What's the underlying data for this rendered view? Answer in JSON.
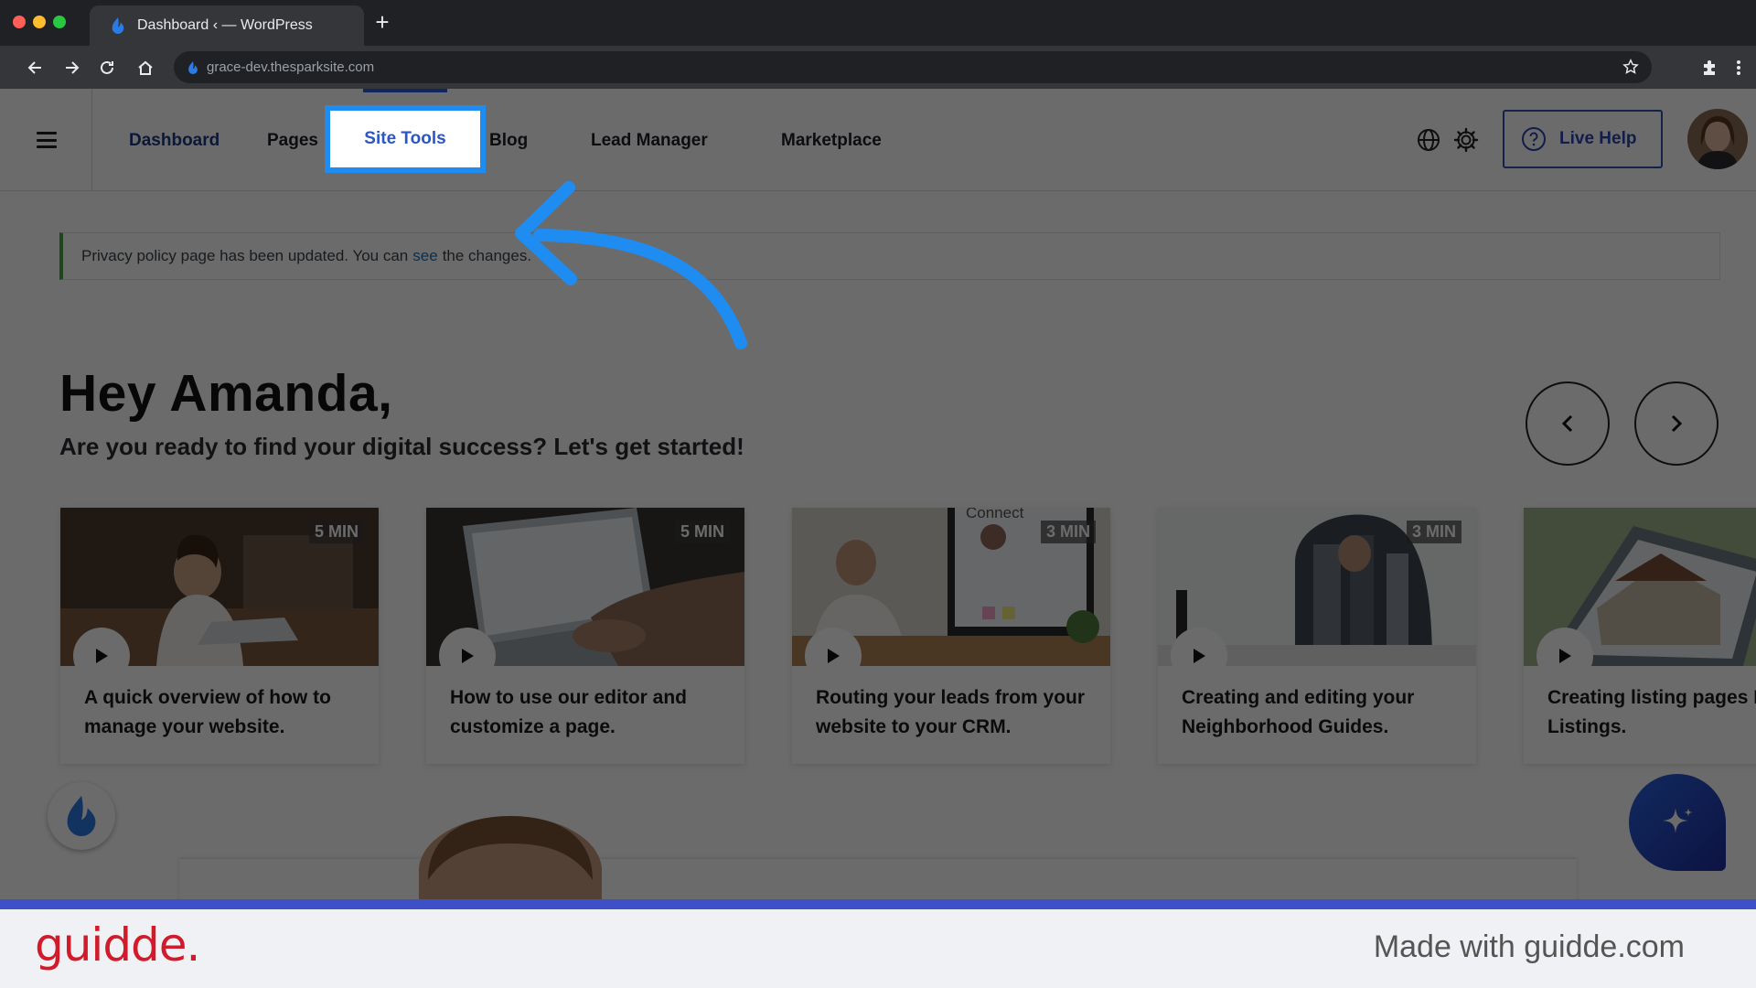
{
  "browser": {
    "tab_title": "Dashboard ‹ — WordPress",
    "new_tab_symbol": "+",
    "url": "grace-dev.thesparksite.com"
  },
  "nav": {
    "items": [
      {
        "label": "Dashboard"
      },
      {
        "label": "Pages"
      },
      {
        "label": "Site Tools"
      },
      {
        "label": "Blog"
      },
      {
        "label": "Lead Manager"
      },
      {
        "label": "Marketplace"
      }
    ],
    "live_help": "Live Help"
  },
  "notice": {
    "prefix": "Privacy policy page has been updated. You can",
    "link": "see",
    "suffix": "the changes."
  },
  "greeting": {
    "title": "Hey Amanda,",
    "subtitle": "Are you ready to find your digital success? Let's get started!"
  },
  "cards": [
    {
      "duration": "5 MIN",
      "title": "A quick overview of how to manage your website."
    },
    {
      "duration": "5 MIN",
      "title": "How to use our editor and customize a page."
    },
    {
      "duration": "3 MIN",
      "title": "Routing your leads from your website to your CRM.",
      "screen_text": "Connect"
    },
    {
      "duration": "3 MIN",
      "title": "Creating and editing your Neighborhood Guides."
    },
    {
      "duration": "",
      "title": "Creating listing pages My Listings."
    }
  ],
  "footer": {
    "brand": "guidde.",
    "made_with": "Made with guidde.com"
  },
  "colors": {
    "highlight_border": "#1e8cf0",
    "arrow": "#1e8cf0",
    "brand_red": "#d11a2a",
    "active_nav": "#1d3a8a"
  },
  "icons": [
    "hamburger-icon",
    "globe-icon",
    "gear-icon",
    "help-circle-icon",
    "chevron-left-icon",
    "chevron-right-icon",
    "play-icon",
    "flame-icon",
    "sparkle-icon",
    "star-icon",
    "extensions-icon"
  ]
}
